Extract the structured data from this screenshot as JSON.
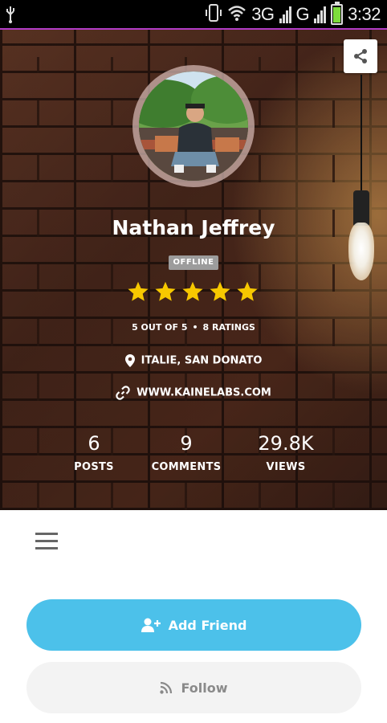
{
  "status_bar": {
    "network_3g_1": "3G",
    "network_3g_2": "G",
    "time": "3:32"
  },
  "profile": {
    "name": "Nathan Jeffrey",
    "status_badge": "OFFLINE",
    "rating_value": 5,
    "rating_max": 5,
    "rating_text": "5 OUT OF 5",
    "ratings_count_text": "8 RATINGS",
    "location": "ITALIE, SAN DONATO",
    "website": "WWW.KAINELABS.COM"
  },
  "stats": [
    {
      "value": "6",
      "label": "POSTS"
    },
    {
      "value": "9",
      "label": "COMMENTS"
    },
    {
      "value": "29.8K",
      "label": "VIEWS"
    }
  ],
  "actions": {
    "add_friend": "Add Friend",
    "follow": "Follow"
  },
  "colors": {
    "accent": "#4cc1ea",
    "star": "#f7c800",
    "badge": "#9c9c9c",
    "follow_bg": "#f3f3f3"
  },
  "icons": [
    "share-icon",
    "map-pin-icon",
    "link-icon",
    "menu-icon",
    "user-plus-icon",
    "rss-icon",
    "star-icon"
  ]
}
